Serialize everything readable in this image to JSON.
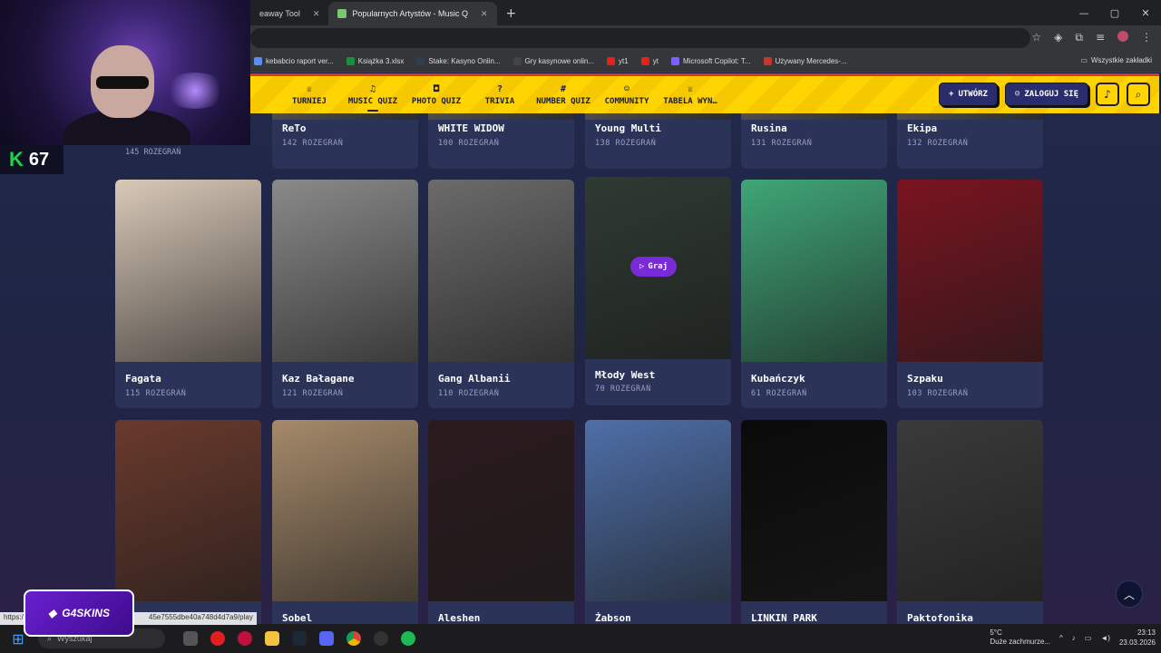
{
  "browser": {
    "tabs": [
      {
        "label": "eaway Tool",
        "active": false
      },
      {
        "label": "Popularnych Artystów - Music Q",
        "active": true
      }
    ],
    "new_tab": "+",
    "bookmarks": [
      {
        "label": "kebabcio raport ver...",
        "color": "#5b8def"
      },
      {
        "label": "Książka 3.xlsx",
        "color": "#1e8e3e"
      },
      {
        "label": "Stake: Kasyno Onlin...",
        "color": "#2f3f4f"
      },
      {
        "label": "Gry kasynowe onlin...",
        "color": "#444"
      },
      {
        "label": "yt1",
        "color": "#e62117"
      },
      {
        "label": "yt",
        "color": "#e62117"
      },
      {
        "label": "Microsoft Copilot: T...",
        "color": "#7b61ff"
      },
      {
        "label": "Używany Mercedes-...",
        "color": "#c0392b"
      }
    ],
    "bookmarks_folder": "Wszystkie zakładki",
    "status_url": "https:/",
    "status_url_tail": "45e7555dbe40a748d4d7a9/play"
  },
  "stream": {
    "kick_score": "67",
    "sponsor": "G4SKINS"
  },
  "nav": {
    "items": [
      {
        "icon": "♕",
        "label": "TURNIEJ"
      },
      {
        "icon": "♫",
        "label": "MUSIC QUIZ",
        "active": true
      },
      {
        "icon": "◘",
        "label": "PHOTO QUIZ"
      },
      {
        "icon": "?",
        "label": "TRIVIA"
      },
      {
        "icon": "#",
        "label": "NUMBER QUIZ"
      },
      {
        "icon": "☺",
        "label": "COMMUNITY"
      },
      {
        "icon": "♕",
        "label": "TABELA WYN…"
      }
    ],
    "create_label": "UTWÓRZ",
    "login_label": "ZALOGUJ SIĘ"
  },
  "cards_row1": [
    {
      "title": "ReTo",
      "plays": "142 ROZEGRAŃ"
    },
    {
      "title": "WHITE WIDOW",
      "plays": "100 ROZEGRAŃ"
    },
    {
      "title": "Young Multi",
      "plays": "138 ROZEGRAŃ"
    },
    {
      "title": "Rusina",
      "plays": "131 ROZEGRAŃ"
    },
    {
      "title": "Ekipa",
      "plays": "132 ROZEGRAŃ"
    }
  ],
  "row1_left_plays": "145 ROZEGRAŃ",
  "cards_row2": [
    {
      "title": "Fagata",
      "plays": "115 ROZEGRAŃ",
      "color": "#d9c9b8"
    },
    {
      "title": "Kaz Bałagane",
      "plays": "121 ROZEGRAŃ",
      "color": "#8a8a8a"
    },
    {
      "title": "Gang Albanii",
      "plays": "110 ROZEGRAŃ",
      "color": "#6b6b6b"
    },
    {
      "title": "Młody West",
      "plays": "70 ROZEGRAŃ",
      "color": "#2f3a33",
      "hover": true
    },
    {
      "title": "Kubańczyk",
      "plays": "61 ROZEGRAŃ",
      "color": "#3fa677"
    },
    {
      "title": "Szpaku",
      "plays": "103 ROZEGRAŃ",
      "color": "#7a1420"
    }
  ],
  "cards_row3": [
    {
      "title": "",
      "color": "#6a3a2c"
    },
    {
      "title": "Sobel",
      "color": "#a68a6a"
    },
    {
      "title": "Aleshen",
      "color": "#2b1a1e"
    },
    {
      "title": "Żabson",
      "color": "#4e6fa8"
    },
    {
      "title": "LINKIN PARK",
      "color": "#0a0a0a"
    },
    {
      "title": "Paktofonika",
      "color": "#3a3a3a"
    }
  ],
  "play_button": "Graj",
  "taskbar": {
    "search": "Wyszukaj",
    "weather_temp": "5°C",
    "weather_desc": "Duże zachmurze...",
    "time": "23:13",
    "date": "23.03.2026"
  }
}
